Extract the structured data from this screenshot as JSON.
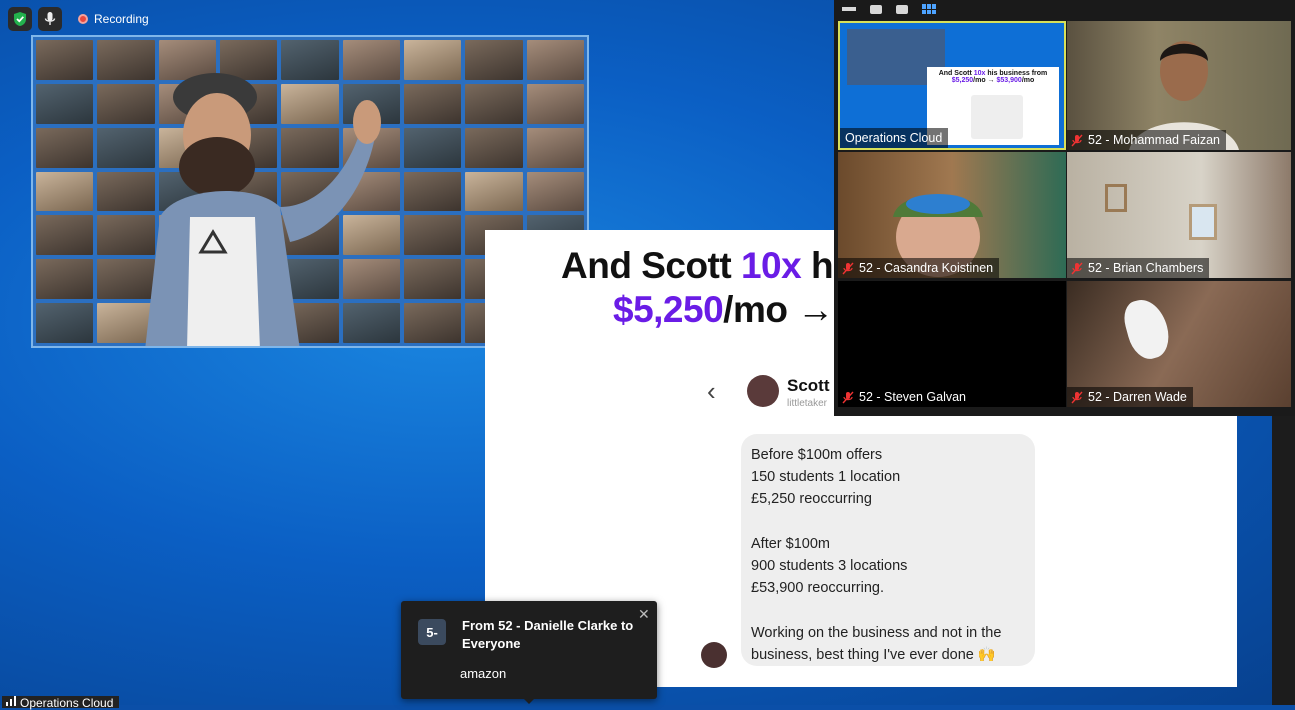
{
  "status_bar": {
    "recording_label": "Recording"
  },
  "slide": {
    "title_line1_pre": "And Scott ",
    "title_line1_hl": "10x",
    "title_line1_post": " h",
    "title_line2_hl": "$5,250",
    "title_line2_post": "/mo →",
    "chat_name": "Scott",
    "chat_handle": "littletaker",
    "message": "Before $100m offers\n150 students 1 location\n£5,250 reoccurring\n\nAfter $100m\n900 students 3 locations\n£53,900 reoccurring.\n\nWorking on the business and not in the business, best thing I've ever done 🙌"
  },
  "gallery": {
    "tiles": [
      {
        "name": "Operations Cloud"
      },
      {
        "name": "52 - Mohammad Faizan"
      },
      {
        "name": "52 - Casandra Koistinen"
      },
      {
        "name": "52 - Brian Chambers"
      },
      {
        "name": "52 - Steven Galvan"
      },
      {
        "name": "52 - Darren Wade"
      }
    ],
    "mini_slide": {
      "title_pre": "And Scott ",
      "title_hl": "10x",
      "title_post": " his business from",
      "line2_a": "$5,250",
      "line2_b": "/mo → ",
      "line2_c": "$53,900",
      "line2_d": "/mo"
    }
  },
  "toast": {
    "badge": "5-",
    "from": "From 52 - Danielle Clarke to Everyone",
    "message": "amazon"
  },
  "self_view": {
    "label": "Operations Cloud"
  },
  "colors": {
    "accent_purple": "#6a1ce6",
    "recording_red": "#e8483e",
    "active_speaker_border": "#d7e05a"
  }
}
